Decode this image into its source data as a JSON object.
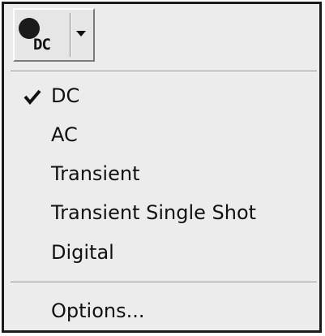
{
  "toolbar": {
    "button_icon": "dc-analysis-icon",
    "icon_text": "DC",
    "dropdown_icon": "chevron-down-icon"
  },
  "menu": {
    "items": [
      {
        "label": "DC",
        "checked": true
      },
      {
        "label": "AC",
        "checked": false
      },
      {
        "label": "Transient",
        "checked": false
      },
      {
        "label": "Transient Single Shot",
        "checked": false
      },
      {
        "label": "Digital",
        "checked": false
      }
    ],
    "options_label": "Options..."
  }
}
